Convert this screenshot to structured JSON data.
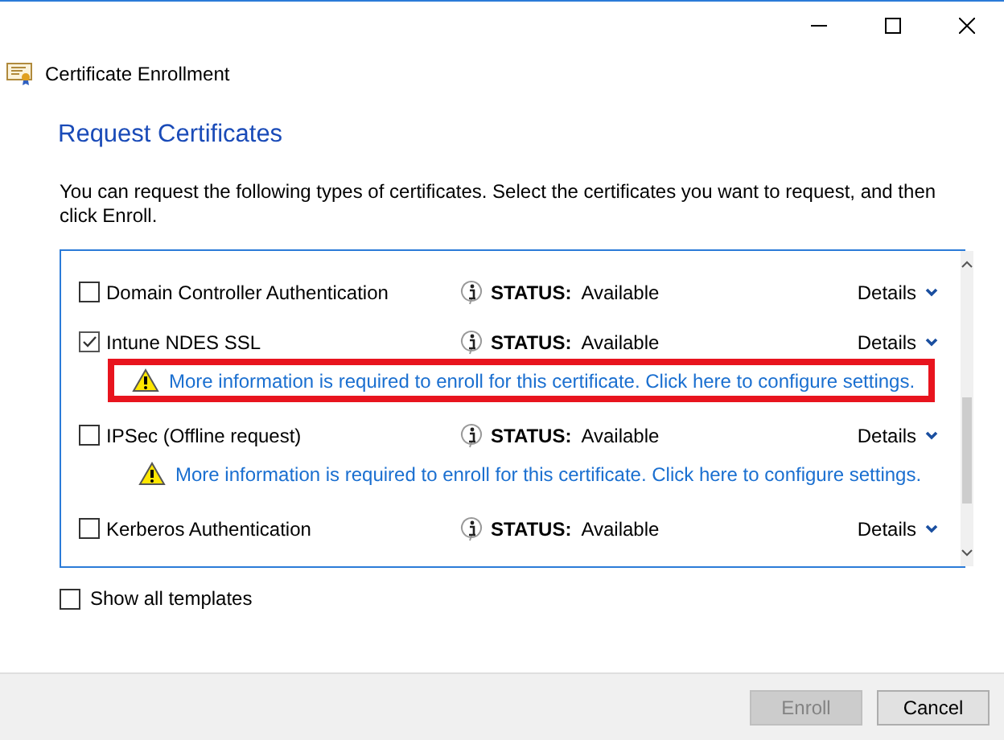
{
  "window": {
    "title": "Certificate Enrollment"
  },
  "heading": "Request Certificates",
  "description": "You can request the following types of certificates. Select the certificates you want to request, and then click Enroll.",
  "certificates": [
    {
      "name": "Domain Controller Authentication",
      "checked": false,
      "status_label": "STATUS:",
      "status": "Available",
      "details": "Details"
    },
    {
      "name": "Intune NDES SSL",
      "checked": true,
      "status_label": "STATUS:",
      "status": "Available",
      "details": "Details",
      "warning": {
        "text": "More information is required to enroll for this certificate. Click here to configure settings.",
        "highlighted": true
      }
    },
    {
      "name": "IPSec (Offline request)",
      "checked": false,
      "status_label": "STATUS:",
      "status": "Available",
      "details": "Details",
      "warning": {
        "text": "More information is required to enroll for this certificate. Click here to configure settings.",
        "highlighted": false
      }
    },
    {
      "name": "Kerberos Authentication",
      "checked": false,
      "status_label": "STATUS:",
      "status": "Available",
      "details": "Details"
    }
  ],
  "show_all_templates": {
    "label": "Show all templates",
    "checked": false
  },
  "buttons": [
    {
      "label": "Enroll",
      "disabled": true
    },
    {
      "label": "Cancel",
      "disabled": false
    }
  ]
}
